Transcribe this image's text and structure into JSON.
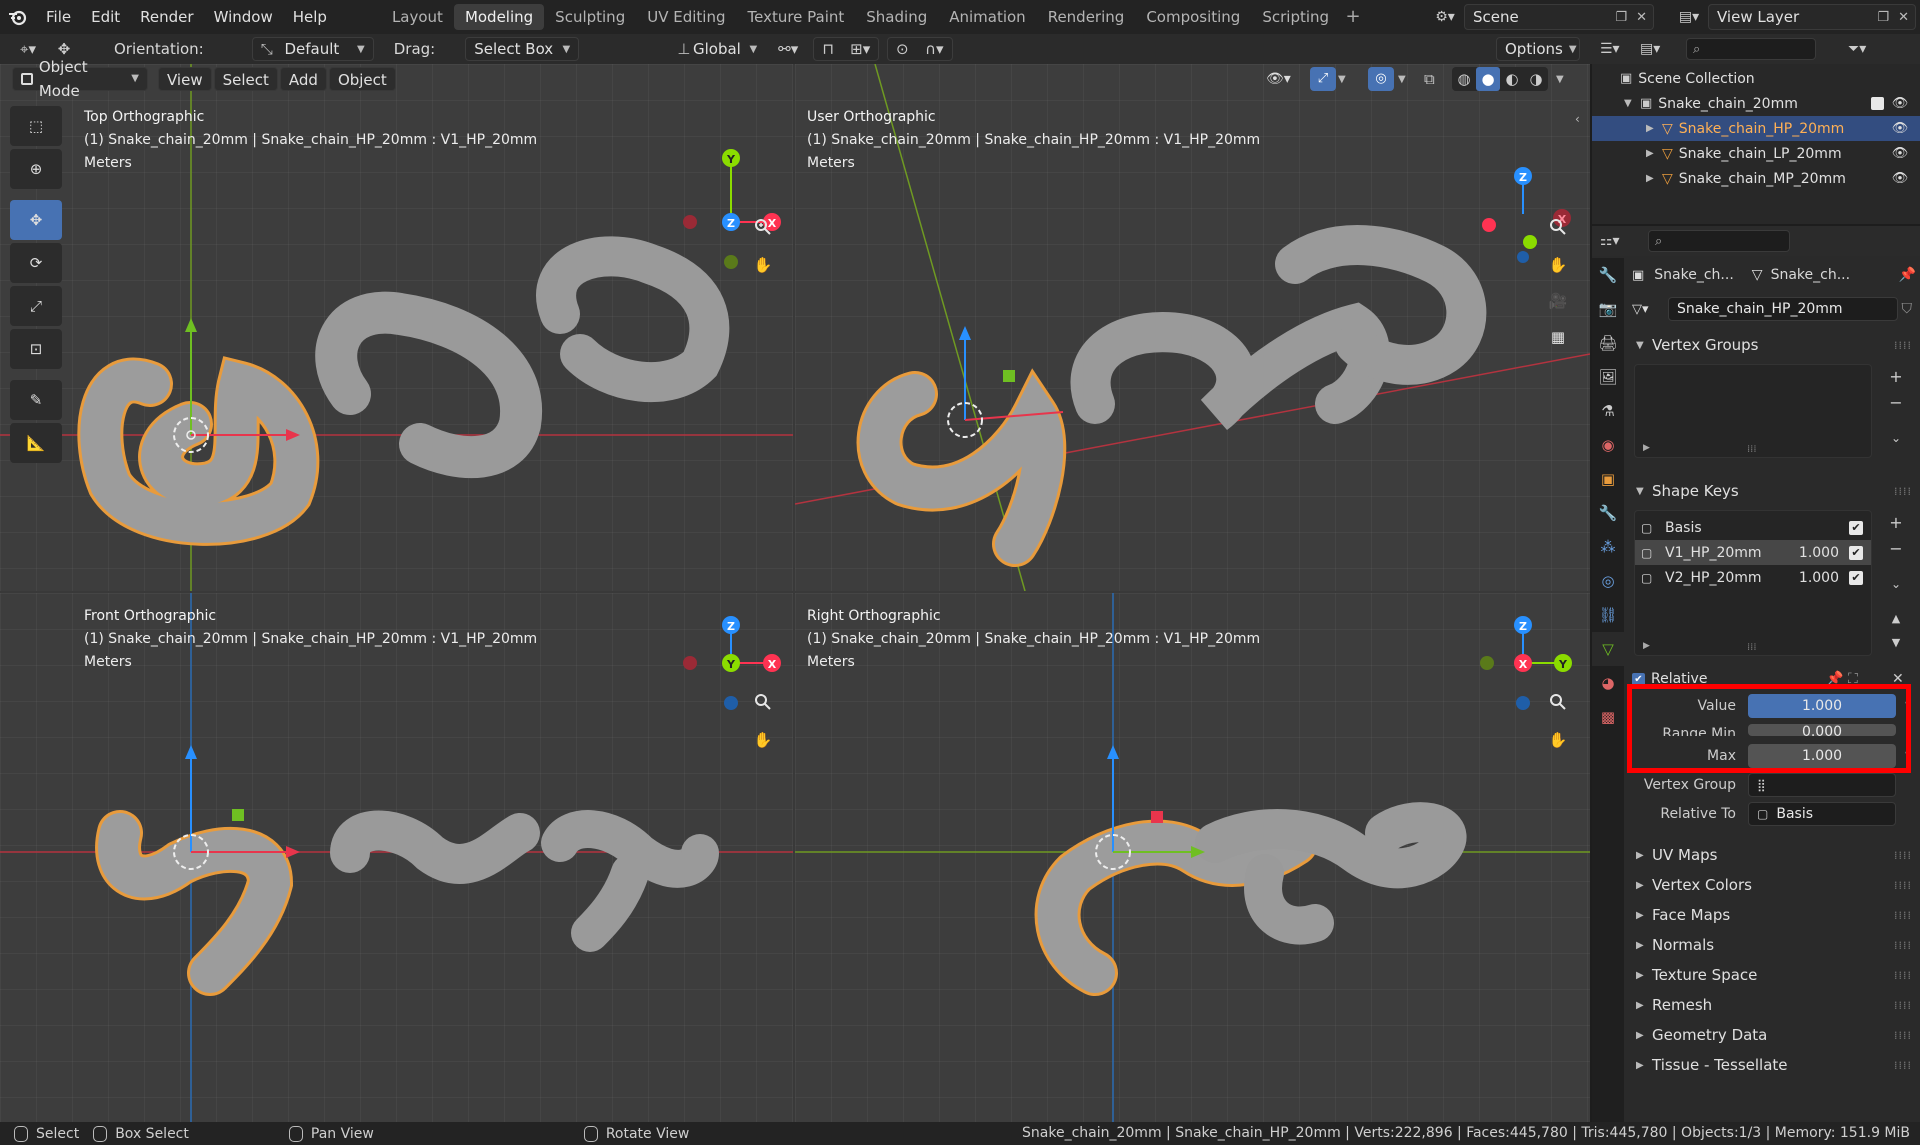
{
  "menu": [
    "File",
    "Edit",
    "Render",
    "Window",
    "Help"
  ],
  "workspaces": [
    {
      "label": "Layout",
      "active": false
    },
    {
      "label": "Modeling",
      "active": true
    },
    {
      "label": "Sculpting",
      "active": false
    },
    {
      "label": "UV Editing",
      "active": false
    },
    {
      "label": "Texture Paint",
      "active": false
    },
    {
      "label": "Shading",
      "active": false
    },
    {
      "label": "Animation",
      "active": false
    },
    {
      "label": "Rendering",
      "active": false
    },
    {
      "label": "Compositing",
      "active": false
    },
    {
      "label": "Scripting",
      "active": false
    }
  ],
  "scene": "Scene",
  "view_layer": "View Layer",
  "toolbar": {
    "orientation_label": "Orientation:",
    "orientation_value": "Default",
    "drag_label": "Drag:",
    "drag_value": "Select Box",
    "transform_value": "Global",
    "options_label": "Options"
  },
  "viewport_header": {
    "mode": "Object Mode",
    "menus": [
      "View",
      "Select",
      "Add",
      "Object"
    ]
  },
  "viewports": [
    {
      "title": "Top Orthographic",
      "object": "(1) Snake_chain_20mm | Snake_chain_HP_20mm : V1_HP_20mm",
      "units": "Meters"
    },
    {
      "title": "User Orthographic",
      "object": "(1) Snake_chain_20mm | Snake_chain_HP_20mm : V1_HP_20mm",
      "units": "Meters"
    },
    {
      "title": "Front Orthographic",
      "object": "(1) Snake_chain_20mm | Snake_chain_HP_20mm : V1_HP_20mm",
      "units": "Meters"
    },
    {
      "title": "Right Orthographic",
      "object": "(1) Snake_chain_20mm | Snake_chain_HP_20mm : V1_HP_20mm",
      "units": "Meters"
    }
  ],
  "outliner": {
    "root": "Scene Collection",
    "collection": "Snake_chain_20mm",
    "objects": [
      {
        "name": "Snake_chain_HP_20mm",
        "selected": true
      },
      {
        "name": "Snake_chain_LP_20mm",
        "selected": false
      },
      {
        "name": "Snake_chain_MP_20mm",
        "selected": false
      }
    ]
  },
  "properties": {
    "breadcrumb_object": "Snake_ch...",
    "breadcrumb_mesh": "Snake_ch...",
    "mesh_name": "Snake_chain_HP_20mm",
    "vertex_groups_label": "Vertex Groups",
    "shape_keys_label": "Shape Keys",
    "shape_keys": [
      {
        "name": "Basis",
        "value": "",
        "checked": true,
        "selected": false
      },
      {
        "name": "V1_HP_20mm",
        "value": "1.000",
        "checked": true,
        "selected": true
      },
      {
        "name": "V2_HP_20mm",
        "value": "1.000",
        "checked": true,
        "selected": false
      }
    ],
    "relative_label": "Relative",
    "value_label": "Value",
    "value": "1.000",
    "range_min_label": "Range Min",
    "range_min": "0.000",
    "max_label": "Max",
    "max": "1.000",
    "vertex_group_label": "Vertex Group",
    "relative_to_label": "Relative To",
    "relative_to": "Basis",
    "collapsed_panels": [
      "UV Maps",
      "Vertex Colors",
      "Face Maps",
      "Normals",
      "Texture Space",
      "Remesh",
      "Geometry Data",
      "Tissue - Tessellate"
    ]
  },
  "status": {
    "select": "Select",
    "box_select": "Box Select",
    "pan_view": "Pan View",
    "rotate_view": "Rotate View",
    "stats": "Snake_chain_20mm | Snake_chain_HP_20mm | Verts:222,896 | Faces:445,780 | Tris:445,780 | Objects:1/3 | Memory: 151.9 MiB"
  },
  "colors": {
    "accent_blue": "#4772b3",
    "selection_orange": "#ffb055",
    "axis_x": "#ff3352",
    "axis_y": "#8bdc00",
    "axis_z": "#2890ff",
    "highlight_red": "#ff0000"
  }
}
